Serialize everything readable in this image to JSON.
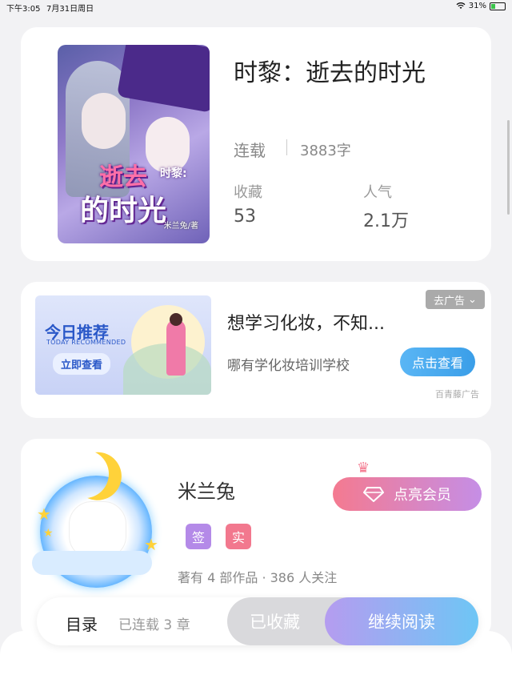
{
  "status_bar": {
    "time": "下午3:05",
    "date": "7月31日周日",
    "battery": "31%",
    "battery_level": 0.31
  },
  "book": {
    "title": "时黎：逝去的时光",
    "status": "连载",
    "word_count": "3883字",
    "stats": [
      {
        "label": "收藏",
        "value": "53"
      },
      {
        "label": "人气",
        "value": "2.1万"
      }
    ],
    "cover": {
      "title_top": "逝去",
      "title_side": "时黎:",
      "title_bottom": "的时光",
      "author_sig": "米兰兔/著"
    }
  },
  "ad": {
    "image": {
      "title": "今日推荐",
      "subtitle": "TODAY RECOMMENDED",
      "cta": "立即查看"
    },
    "headline": "想学习化妆，不知...",
    "description": "哪有学化妆培训学校",
    "button_label": "点击查看",
    "close_label": "去广告",
    "source": "百青藤广告"
  },
  "author": {
    "name": "米兰兔",
    "tags": [
      "签",
      "实"
    ],
    "meta": "著有 4 部作品 · 386 人关注",
    "vip_label": "点亮会员"
  },
  "bottom_bar": {
    "toc_label": "目录",
    "toc_count": "已连载 3 章",
    "favorite_label": "已收藏",
    "read_label": "继续阅读"
  },
  "colors": {
    "accent_blue": "#3a9ee8",
    "vip_gradient_start": "#f47a90",
    "vip_gradient_end": "#c58ee6",
    "read_gradient_start": "#b59cf0",
    "read_gradient_end": "#6ec6f5",
    "tag_sign": "#b48ae8",
    "tag_real": "#f2788e"
  }
}
